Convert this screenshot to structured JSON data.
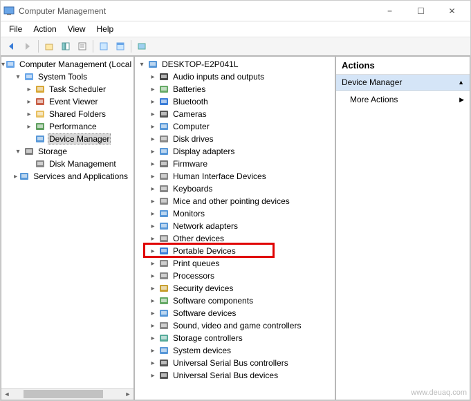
{
  "window": {
    "title": "Computer Management",
    "controls": {
      "minimize": "−",
      "maximize": "☐",
      "close": "✕"
    }
  },
  "menu": [
    "File",
    "Action",
    "View",
    "Help"
  ],
  "toolbar_icons": [
    "back",
    "forward",
    "up",
    "show-hide",
    "properties",
    "help",
    "view1",
    "view2"
  ],
  "left_tree": [
    {
      "depth": 0,
      "expand": "▾",
      "icon": "mgmt",
      "label": "Computer Management (Local"
    },
    {
      "depth": 1,
      "expand": "▾",
      "icon": "tools",
      "label": "System Tools"
    },
    {
      "depth": 2,
      "expand": "▸",
      "icon": "sched",
      "label": "Task Scheduler"
    },
    {
      "depth": 2,
      "expand": "▸",
      "icon": "event",
      "label": "Event Viewer"
    },
    {
      "depth": 2,
      "expand": "▸",
      "icon": "shared",
      "label": "Shared Folders"
    },
    {
      "depth": 2,
      "expand": "▸",
      "icon": "perf",
      "label": "Performance"
    },
    {
      "depth": 2,
      "expand": "",
      "icon": "devmgr",
      "label": "Device Manager",
      "selected": true
    },
    {
      "depth": 1,
      "expand": "▾",
      "icon": "storage",
      "label": "Storage"
    },
    {
      "depth": 2,
      "expand": "",
      "icon": "disk",
      "label": "Disk Management"
    },
    {
      "depth": 1,
      "expand": "▸",
      "icon": "services",
      "label": "Services and Applications"
    }
  ],
  "middle_tree": {
    "root": {
      "expand": "▾",
      "icon": "computer",
      "label": "DESKTOP-E2P041L"
    },
    "children": [
      {
        "icon": "audio",
        "label": "Audio inputs and outputs"
      },
      {
        "icon": "battery",
        "label": "Batteries"
      },
      {
        "icon": "bluetooth",
        "label": "Bluetooth"
      },
      {
        "icon": "camera",
        "label": "Cameras"
      },
      {
        "icon": "computer",
        "label": "Computer"
      },
      {
        "icon": "diskdrive",
        "label": "Disk drives"
      },
      {
        "icon": "display",
        "label": "Display adapters"
      },
      {
        "icon": "firmware",
        "label": "Firmware"
      },
      {
        "icon": "hid",
        "label": "Human Interface Devices"
      },
      {
        "icon": "keyboard",
        "label": "Keyboards"
      },
      {
        "icon": "mouse",
        "label": "Mice and other pointing devices"
      },
      {
        "icon": "monitor",
        "label": "Monitors"
      },
      {
        "icon": "network",
        "label": "Network adapters"
      },
      {
        "icon": "other",
        "label": "Other devices"
      },
      {
        "icon": "portable",
        "label": "Portable Devices",
        "highlighted": true
      },
      {
        "icon": "printer",
        "label": "Print queues"
      },
      {
        "icon": "cpu",
        "label": "Processors"
      },
      {
        "icon": "security",
        "label": "Security devices"
      },
      {
        "icon": "swcomp",
        "label": "Software components"
      },
      {
        "icon": "swdev",
        "label": "Software devices"
      },
      {
        "icon": "sound",
        "label": "Sound, video and game controllers"
      },
      {
        "icon": "storctrl",
        "label": "Storage controllers"
      },
      {
        "icon": "sysdev",
        "label": "System devices"
      },
      {
        "icon": "usbctrl",
        "label": "Universal Serial Bus controllers"
      },
      {
        "icon": "usbdev",
        "label": "Universal Serial Bus devices"
      }
    ]
  },
  "actions": {
    "header": "Actions",
    "section": "Device Manager",
    "items": [
      "More Actions"
    ]
  },
  "watermark": "www.deuaq.com"
}
